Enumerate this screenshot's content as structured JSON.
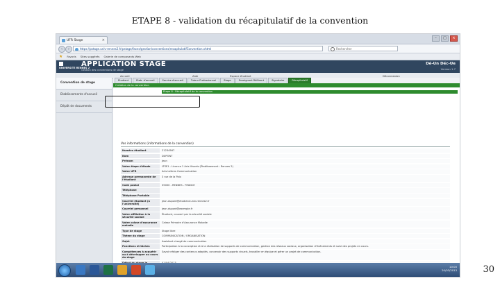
{
  "slide": {
    "title": "ETAPE 8 - validation du récapitulatif de la convention",
    "page_number": "30"
  },
  "browser": {
    "tab_label": "UFR Stage",
    "url": "https://pstage.univ-rennes2.fr/pstage/faces/gestion/conventions/recapitulatifConvention.xhtml",
    "search_placeholder": "Rechercher"
  },
  "favorites": [
    "Favoris",
    "Sites suggérés",
    "Galerie de composants Web"
  ],
  "app": {
    "logo_text": "UNIVERSITE RENNES 2",
    "title": "APPLICATION STAGE",
    "subtitle": "Gestion des conventions de stage",
    "logout": "Dé-Un Déc-Ue",
    "version": "Version 1.7"
  },
  "subnav": [
    "Accueil",
    "Aide",
    "Espace étudiant",
    "Déconnexion"
  ],
  "left_menu": [
    {
      "label": "Convention de stage",
      "active": true
    },
    {
      "label": "Etablissements d'accueil",
      "active": false
    },
    {
      "label": "Dépôt de documents",
      "active": false
    }
  ],
  "main_tabs": [
    {
      "label": "Etudiant",
      "active": false
    },
    {
      "label": "Etab. d'accueil",
      "active": false
    },
    {
      "label": "Service d'accueil",
      "active": false
    },
    {
      "label": "Tuteur Professionnel",
      "active": false
    },
    {
      "label": "Stage",
      "active": false
    },
    {
      "label": "Enseignant Référent",
      "active": false
    },
    {
      "label": "Signataire",
      "active": false
    },
    {
      "label": "Récapitulatif",
      "active": true
    }
  ],
  "green_header": "Création de la convention",
  "step_label": "Etape 8 : Récapitulatif de la convention",
  "section_title": "Vos informations (informations de la convention)",
  "fields": [
    {
      "label": "Numéro étudiant",
      "value": "21234567"
    },
    {
      "label": "Nom",
      "value": "DUPONT"
    },
    {
      "label": "Prénom",
      "value": "Jean"
    },
    {
      "label": "Votre étape d'étude",
      "value": "LTSE1 - Licence 1 Arts Visuels (Établissement : Rennes 2)"
    },
    {
      "label": "Votre UFR",
      "value": "Arts Lettres Communication"
    },
    {
      "label": "Adresse permanente de l'étudiant",
      "value": "3 rue de la Paix"
    },
    {
      "label": "Code postal",
      "value": "35000 - RENNES - FRANCE"
    },
    {
      "label": "Téléphone",
      "value": ""
    },
    {
      "label": "Téléphone Portable",
      "value": ""
    },
    {
      "label": "Courriel étudiant (à l'université)",
      "value": "jean.dupont@etudiant.univ-rennes2.fr"
    },
    {
      "label": "Courriel personnel",
      "value": "jean.dupont@exemple.fr"
    },
    {
      "label": "Votre affiliation à la sécurité sociale",
      "value": "Étudiant, couvert par la sécurité sociale"
    },
    {
      "label": "Votre caisse d'assurance maladie",
      "value": "Caisse Primaire d'Assurance Maladie"
    },
    {
      "label": "Type de stage",
      "value": "Stage libre"
    },
    {
      "label": "Thème du stage",
      "value": "COMMUNICATION / ORGANISATION"
    },
    {
      "label": "Sujet",
      "value": "Assistant chargé de communication"
    },
    {
      "label": "Fonctions et tâches",
      "value": "Participation à la conception et à la réalisation de supports de communication, gestion des réseaux sociaux, organisation d'événements et suivi des projets en cours."
    },
    {
      "label": "Compétences à acquérir ou à développer au cours du stage",
      "value": "Savoir rédiger des contenus adaptés, concevoir des supports visuels, travailler en équipe et gérer un projet de communication."
    },
    {
      "label": "Début du stage le",
      "value": "01/04/2013"
    }
  ],
  "taskbar": {
    "time": "10:00",
    "date": "20/03/2013"
  },
  "colors": {
    "app_header": "#30465f",
    "active_tab": "#2b7d2b",
    "green_bar": "#2e8b2e"
  }
}
